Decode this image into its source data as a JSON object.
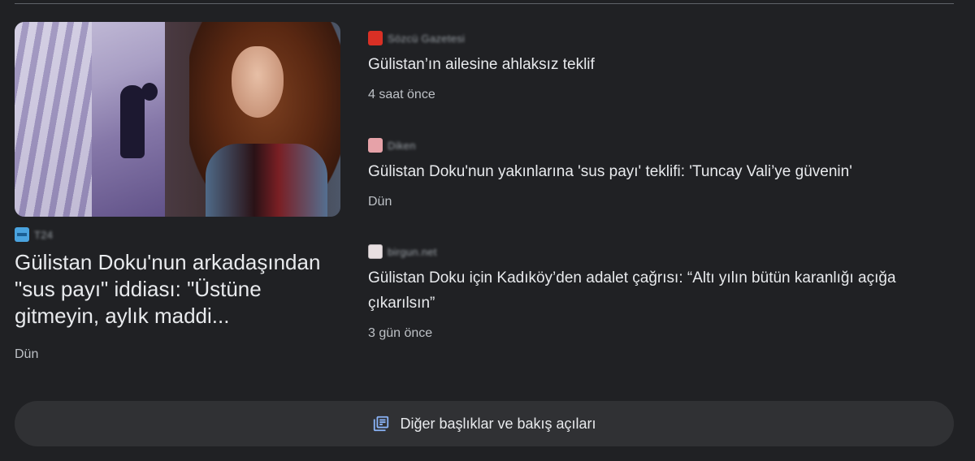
{
  "featured": {
    "source": "T24",
    "title": "Gülistan Doku'nun arkadaşından \"sus payı\" iddiası: \"Üstüne gitmeyin, aylık maddi...",
    "time": "Dün"
  },
  "stories": [
    {
      "source": "Sözcü Gazetesi",
      "headline": "Gülistan’ın ailesine ahlaksız teklif",
      "time": "4 saat önce",
      "icon_color": "#d93025"
    },
    {
      "source": "Diken",
      "headline": "Gülistan Doku'nun yakınlarına 'sus payı' teklifi: 'Tuncay Vali’ye güvenin'",
      "time": "Dün",
      "icon_color": "#e6a2a8"
    },
    {
      "source": "birgun.net",
      "headline": "Gülistan Doku için Kadıköy’den adalet çağrısı: “Altı yılın bütün karanlığı açığa çıkarılsın”",
      "time": "3 gün önce",
      "icon_color": "#e8dfe1"
    }
  ],
  "more_button": {
    "label": "Diğer başlıklar ve bakış açıları",
    "icon": "newspaper-icon",
    "accent": "#8ab4f8"
  }
}
